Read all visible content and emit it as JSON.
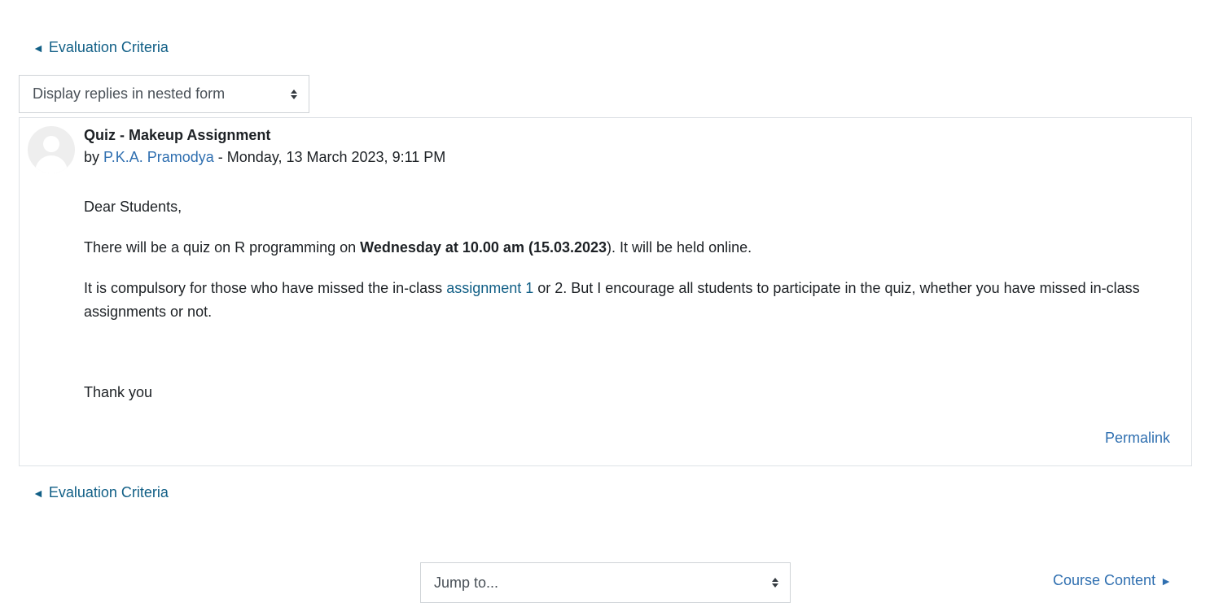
{
  "navigation": {
    "prev_arrow": "◄",
    "prev_label": "Evaluation Criteria",
    "next_label": "Course Content",
    "next_arrow": "►"
  },
  "display_mode": {
    "selected": "Display replies in nested form"
  },
  "jump_to": {
    "selected": "Jump to..."
  },
  "post": {
    "title": "Quiz - Makeup Assignment",
    "by": "by",
    "author": "P.K.A. Pramodya",
    "separator": " - ",
    "date": "Monday, 13 March 2023, 9:11 PM",
    "greeting": "Dear Students,",
    "p1_before": "There will be a quiz on R programming on ",
    "p1_bold": "Wednesday at 10.00 am (15.03.2023",
    "p1_after": "). It will be held online.",
    "p2_before": "It is compulsory for those who have missed the in-class ",
    "p2_link": "assignment 1",
    "p2_after": " or 2. But I encourage all students to participate in the quiz, whether you have missed in-class assignments or not.",
    "closing": "Thank you",
    "permalink": "Permalink"
  },
  "icons": {
    "avatar": "default-user-avatar-icon",
    "select_caret": "sort-caret-icon"
  },
  "colors": {
    "link": "#115f86",
    "author_link": "#2f6fb0",
    "border": "#dee2e6"
  }
}
